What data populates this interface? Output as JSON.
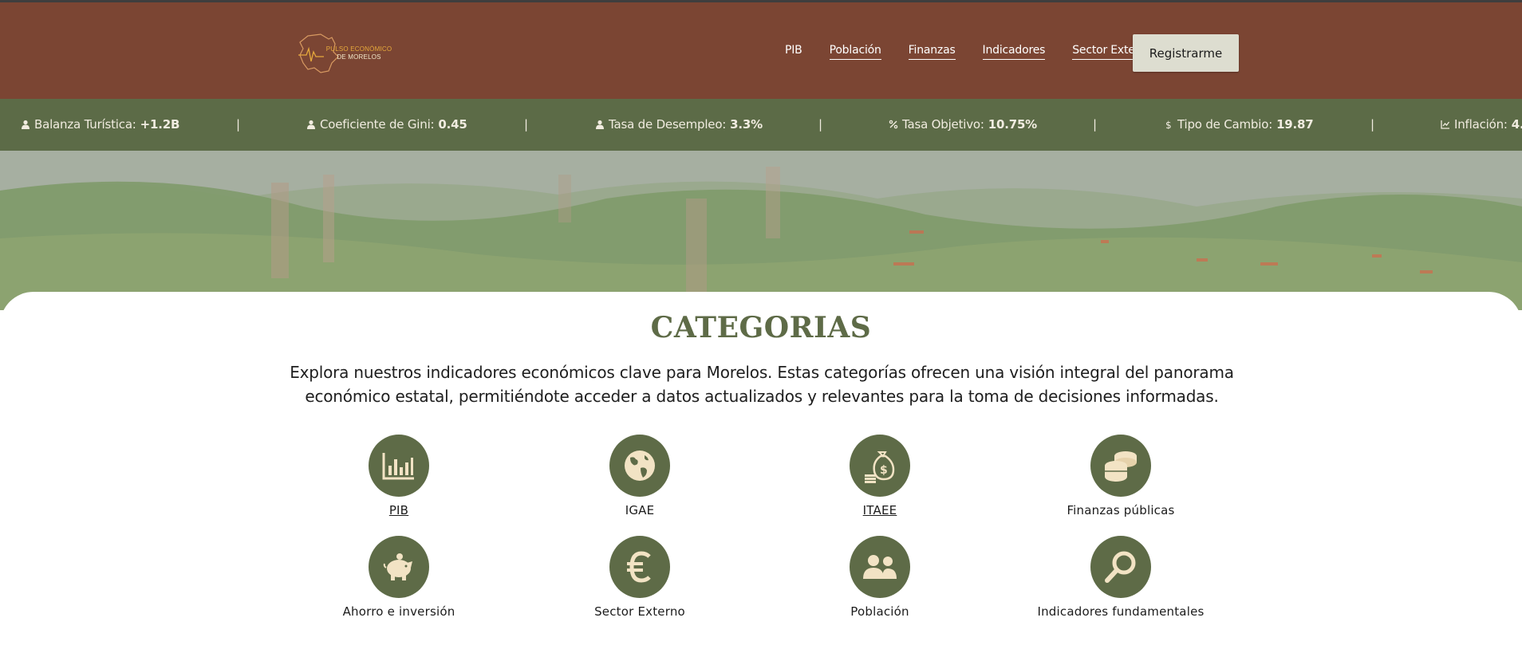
{
  "header": {
    "logo_line1": "PULSO ECONÓMICO",
    "logo_line2": "DE MORELOS",
    "nav": [
      {
        "label": "PIB"
      },
      {
        "label": "Población"
      },
      {
        "label": "Finanzas"
      },
      {
        "label": "Indicadores"
      },
      {
        "label": "Sector Externo"
      }
    ],
    "register_label": "Registrarme"
  },
  "ticker": [
    {
      "label": "Balanza Turística:",
      "value": "+1.2B",
      "icon": "person-icon"
    },
    {
      "label": "Coeficiente de Gini:",
      "value": "0.45",
      "icon": "person-icon"
    },
    {
      "label": "Tasa de Desempleo:",
      "value": "3.3%",
      "icon": "person-icon"
    },
    {
      "label": "Tasa Objetivo:",
      "value": "10.75%",
      "icon": "percent-icon"
    },
    {
      "label": "Tipo de Cambio:",
      "value": "19.87",
      "icon": "dollar-icon"
    },
    {
      "label": "Inflación:",
      "value": "4.",
      "icon": "chart-line-icon"
    }
  ],
  "ticker_separator": "|",
  "main": {
    "title": "CATEGORIAS",
    "description_line1": "Explora nuestros indicadores económicos clave para Morelos. Estas categorías ofrecen una visión integral del panorama",
    "description_line2": "económico estatal, permitiéndote acceder a datos actualizados y relevantes para la toma de decisiones informadas.",
    "categories": [
      {
        "label": "PIB",
        "icon": "bar-chart-icon"
      },
      {
        "label": "IGAE",
        "icon": "globe-icon"
      },
      {
        "label": "ITAEE",
        "icon": "money-bag-icon"
      },
      {
        "label": "Finanzas públicas",
        "icon": "coins-icon"
      },
      {
        "label": "Ahorro e inversión",
        "icon": "piggy-bank-icon"
      },
      {
        "label": "Sector Externo",
        "icon": "euro-icon"
      },
      {
        "label": "Población",
        "icon": "users-icon"
      },
      {
        "label": "Indicadores fundamentales",
        "icon": "magnifier-icon"
      }
    ]
  },
  "colors": {
    "header_bg": "#7b4533",
    "ticker_bg": "#5c6b47",
    "accent_green": "#5e6b47",
    "icon_fill": "#f2e3c4",
    "register_bg": "#ddddd0"
  }
}
